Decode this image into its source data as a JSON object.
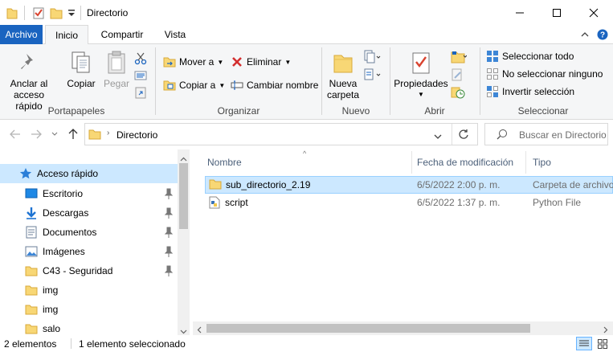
{
  "window": {
    "title": "Directorio"
  },
  "tabs": [
    "Archivo",
    "Inicio",
    "Compartir",
    "Vista"
  ],
  "ribbon": {
    "portapapeles": {
      "label": "Portapapeles",
      "anclar": "Anclar al",
      "anclar2": "acceso rápido",
      "copiar": "Copiar",
      "pegar": "Pegar"
    },
    "organizar": {
      "label": "Organizar",
      "mover": "Mover a",
      "copiar_a": "Copiar a",
      "eliminar": "Eliminar",
      "cambiar_nombre": "Cambiar nombre"
    },
    "nuevo": {
      "label": "Nuevo",
      "nueva": "Nueva",
      "carpeta": "carpeta"
    },
    "abrir": {
      "label": "Abrir",
      "propiedades": "Propiedades"
    },
    "seleccionar": {
      "label": "Seleccionar",
      "todo": "Seleccionar todo",
      "ninguno": "No seleccionar ninguno",
      "invertir": "Invertir selección"
    }
  },
  "address": {
    "path": "Directorio",
    "search_placeholder": "Buscar en Directorio"
  },
  "nav": {
    "quick_access": "Acceso rápido",
    "items": [
      {
        "label": "Escritorio",
        "icon": "desktop-icon",
        "pinned": true
      },
      {
        "label": "Descargas",
        "icon": "downloads-icon",
        "pinned": true
      },
      {
        "label": "Documentos",
        "icon": "documents-icon",
        "pinned": true
      },
      {
        "label": "Imágenes",
        "icon": "pictures-icon",
        "pinned": true
      },
      {
        "label": "C43 - Seguridad",
        "icon": "folder-icon",
        "pinned": true
      },
      {
        "label": "img",
        "icon": "folder-icon",
        "pinned": false
      },
      {
        "label": "img",
        "icon": "folder-icon",
        "pinned": false
      },
      {
        "label": "salo",
        "icon": "folder-icon",
        "pinned": false
      }
    ]
  },
  "columns": {
    "name": "Nombre",
    "date": "Fecha de modificación",
    "type": "Tipo"
  },
  "files": [
    {
      "name": "sub_directorio_2.19",
      "date": "6/5/2022 2:00 p. m.",
      "type": "Carpeta de archivos",
      "selected": true
    },
    {
      "name": "script",
      "date": "6/5/2022 1:37 p. m.",
      "type": "Python File",
      "selected": false
    }
  ],
  "status": {
    "count": "2 elementos",
    "selection": "1 elemento seleccionado"
  },
  "colors": {
    "accent": "#1a64c0",
    "selection": "#cce8ff",
    "folder": "#f8d775"
  }
}
